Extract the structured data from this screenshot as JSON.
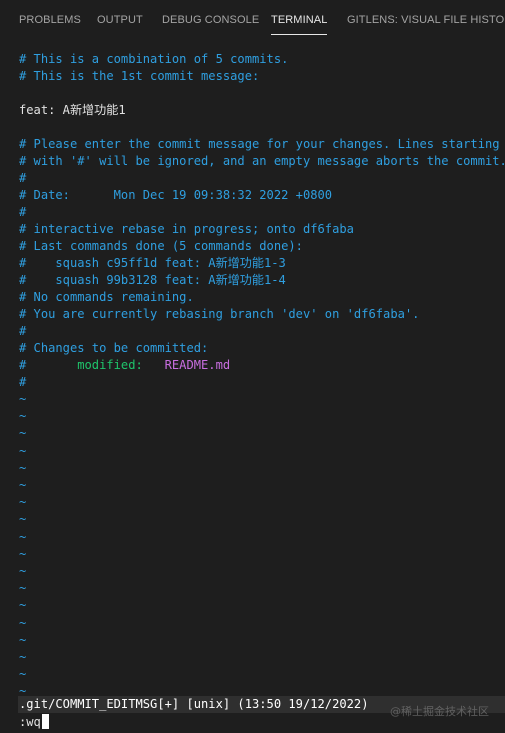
{
  "panel": {
    "tabs": [
      {
        "label": "PROBLEMS"
      },
      {
        "label": "OUTPUT"
      },
      {
        "label": "DEBUG CONSOLE"
      },
      {
        "label": "TERMINAL"
      },
      {
        "label": "GITLENS: VISUAL FILE HISTORY"
      }
    ],
    "active_tab": "TERMINAL"
  },
  "editor": {
    "lines": [
      "# This is a combination of 5 commits.",
      "# This is the 1st commit message:",
      "",
      "feat: A新增功能1",
      "",
      "# Please enter the commit message for your changes. Lines starting",
      "# with '#' will be ignored, and an empty message aborts the commit.",
      "#",
      "# Date:      Mon Dec 19 09:38:32 2022 +0800",
      "#",
      "# interactive rebase in progress; onto df6faba",
      "# Last commands done (5 commands done):",
      "#    squash c95ff1d feat: A新增功能1-3",
      "#    squash 99b3128 feat: A新增功能1-4",
      "# No commands remaining.",
      "# You are currently rebasing branch 'dev' on 'df6faba'.",
      "#",
      "# Changes to be committed:"
    ],
    "modified_line": {
      "hash": "#",
      "label": "modified:",
      "file": "README.md"
    },
    "after_modified": "#",
    "tilde": "~",
    "tilde_count": 18
  },
  "status_line": ".git/COMMIT_EDITMSG[+] [unix] (13:50 19/12/2022)",
  "command_line": ":wq",
  "watermark": "@稀土掘金技术社区",
  "colors": {
    "background": "#1e1e1e",
    "comment_blue": "#2f9fe0",
    "modified_green": "#1ec46b",
    "filename_magenta": "#c86ee0",
    "status_bg": "#2f2f2f"
  }
}
